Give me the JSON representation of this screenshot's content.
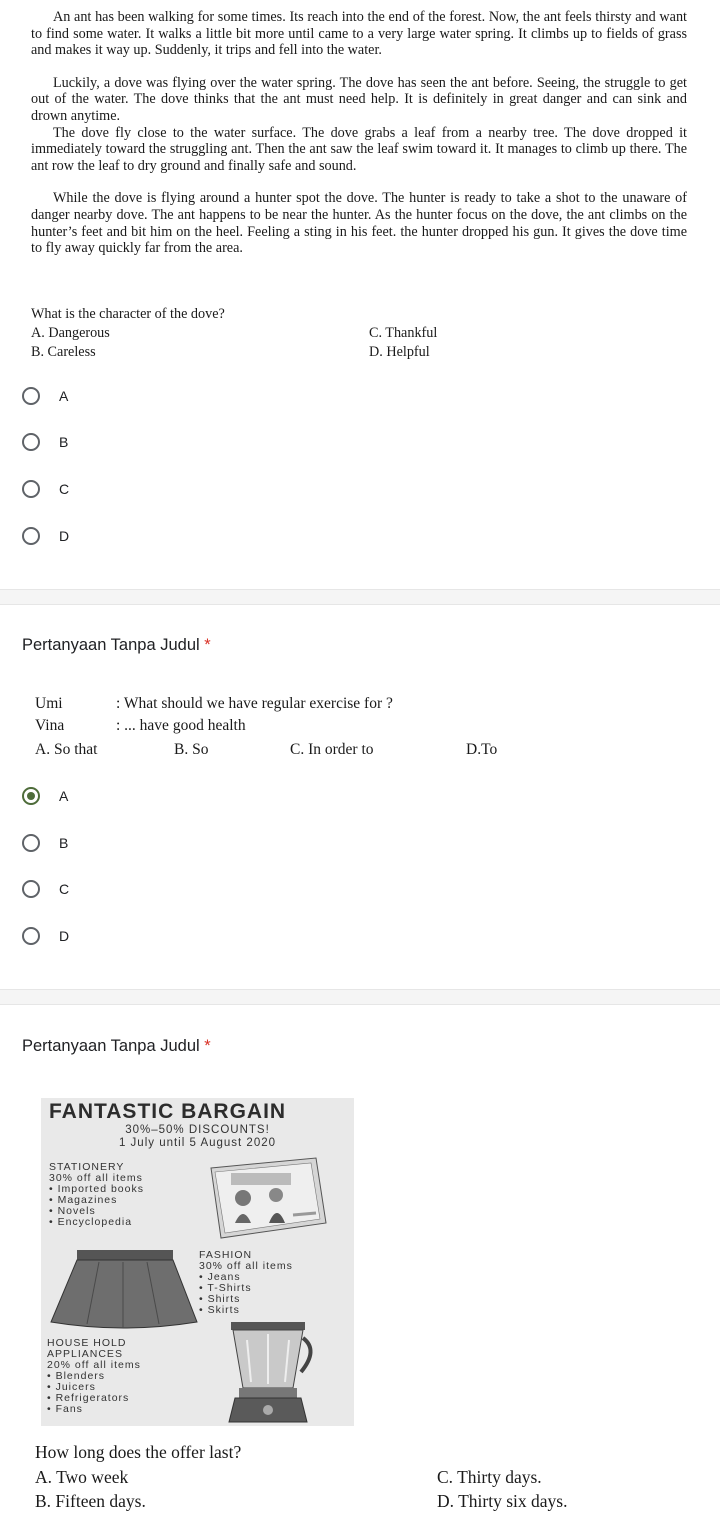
{
  "q1": {
    "passage": [
      "An ant has been walking for some times. Its reach into the end of the forest. Now, the ant feels thirsty and want to find some water. It walks a little bit more until came to a very large water spring. It climbs up to fields of grass and makes it way up. Suddenly, it trips and fell into the water.",
      "Luckily, a dove was flying over the water spring. The dove has seen the ant before. Seeing, the struggle to get out of the water. The dove thinks that the ant must need help. It is definitely in great danger and can sink and drown anytime.",
      "The dove fly close to the water surface. The dove grabs a leaf from a nearby tree. The dove dropped it immediately toward the struggling ant. Then the ant saw the leaf swim toward it. It manages to climb up there. The ant row  the leaf to dry ground and finally safe and sound.",
      "While the dove is flying around a hunter spot the dove. The hunter is ready to take a shot to the unaware of danger nearby dove. The ant happens to be near the hunter. As the hunter focus on the dove, the ant climbs on the hunter’s feet and bit him on the heel. Feeling a sting in his feet. the hunter dropped his gun. It gives the dove time to fly away quickly far from the area."
    ],
    "question": "What is the character of the dove?",
    "opt_a": "A. Dangerous",
    "opt_b": "B. Careless",
    "opt_c": "C. Thankful",
    "opt_d": "D. Helpful",
    "choices": [
      "A",
      "B",
      "C",
      "D"
    ],
    "selected": null
  },
  "q2": {
    "title": "Pertanyaan Tanpa Judul",
    "required_mark": "*",
    "speaker1": "Umi",
    "line1": ": What should we have regular exercise for ?",
    "speaker2": "Vina",
    "line2": ": ... have good health",
    "opt_a": "A. So that",
    "opt_b": "B. So",
    "opt_c": "C. In order to",
    "opt_d": "D.To",
    "choices": [
      "A",
      "B",
      "C",
      "D"
    ],
    "selected": "A"
  },
  "q3": {
    "title": "Pertanyaan Tanpa Judul",
    "required_mark": "*",
    "poster": {
      "heading": "FANTASTIC BARGAIN",
      "discount": "30%–50% DISCOUNTS!",
      "dates": "1 July until 5 August 2020",
      "stationery_title": "STATIONERY",
      "stationery_offer": "30% off all items",
      "stationery_items": [
        "Imported books",
        "Magazines",
        "Novels",
        "Encyclopedia"
      ],
      "fashion_title": "FASHION",
      "fashion_offer": "30% off all items",
      "fashion_items": [
        "Jeans",
        "T-Shirts",
        "Shirts",
        "Skirts"
      ],
      "household_title_1": "HOUSE HOLD",
      "household_title_2": "APPLIANCES",
      "household_offer": "20% off all items",
      "household_items": [
        "Blenders",
        "Juicers",
        "Refrigerators",
        "Fans"
      ]
    },
    "question": "How long does the offer last?",
    "opt_a": "A. Two week",
    "opt_b": "B. Fifteen days.",
    "opt_c": "C. Thirty days.",
    "opt_d": "D. Thirty six days."
  }
}
